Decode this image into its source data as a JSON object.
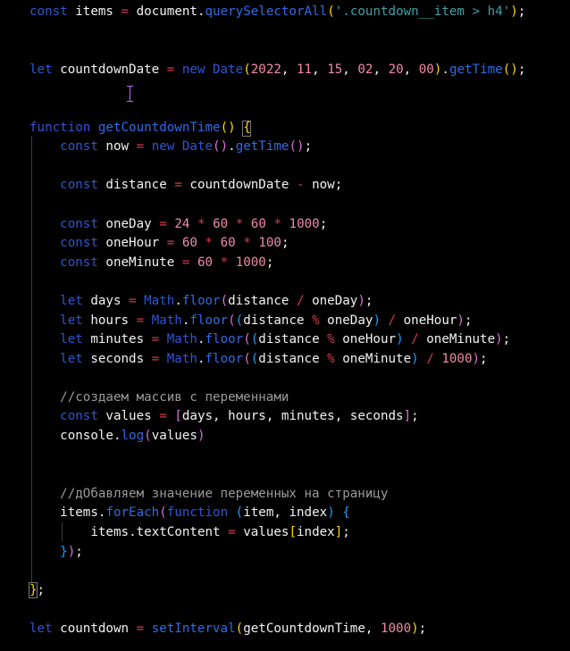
{
  "theme": {
    "background": "#000000",
    "keyword": "#2f55d4",
    "function_name": "#2f6be8",
    "plain": "#f2f2f2",
    "number": "#f08aa8",
    "string": "#3ea0a5",
    "operator": "#d43b4f",
    "comment": "#9a9a9a",
    "paren_outer": "#ffd700",
    "paren_inner": "#da70d6",
    "paren_third": "#179fff",
    "cursor": "#b76cf2"
  },
  "lines": [
    [
      {
        "t": "const",
        "k": "kw"
      },
      {
        "t": " ",
        "k": "p"
      },
      {
        "t": "items",
        "k": "p"
      },
      {
        "t": " ",
        "k": "p"
      },
      {
        "t": "=",
        "k": "op"
      },
      {
        "t": " ",
        "k": "p"
      },
      {
        "t": "document",
        "k": "p"
      },
      {
        "t": ".",
        "k": "p"
      },
      {
        "t": "querySelectorAll",
        "k": "fn"
      },
      {
        "t": "(",
        "k": "b1"
      },
      {
        "t": "'.countdown__item > h4'",
        "k": "str"
      },
      {
        "t": ")",
        "k": "b1"
      },
      {
        "t": ";",
        "k": "p"
      }
    ],
    [],
    [],
    [
      {
        "t": "let",
        "k": "kw"
      },
      {
        "t": " countdownDate ",
        "k": "p"
      },
      {
        "t": "=",
        "k": "op"
      },
      {
        "t": " ",
        "k": "p"
      },
      {
        "t": "new",
        "k": "kw"
      },
      {
        "t": " ",
        "k": "p"
      },
      {
        "t": "Date",
        "k": "kw"
      },
      {
        "t": "(",
        "k": "b1"
      },
      {
        "t": "2022",
        "k": "num"
      },
      {
        "t": ", ",
        "k": "p"
      },
      {
        "t": "11",
        "k": "num"
      },
      {
        "t": ", ",
        "k": "p"
      },
      {
        "t": "15",
        "k": "num"
      },
      {
        "t": ", ",
        "k": "p"
      },
      {
        "t": "02",
        "k": "num"
      },
      {
        "t": ", ",
        "k": "p"
      },
      {
        "t": "20",
        "k": "num"
      },
      {
        "t": ", ",
        "k": "p"
      },
      {
        "t": "00",
        "k": "num"
      },
      {
        "t": ")",
        "k": "b1"
      },
      {
        "t": ".",
        "k": "p"
      },
      {
        "t": "getTime",
        "k": "fn"
      },
      {
        "t": "()",
        "k": "b1"
      },
      {
        "t": ";",
        "k": "p"
      }
    ],
    [],
    [],
    [
      {
        "t": "function",
        "k": "kw"
      },
      {
        "t": " ",
        "k": "p"
      },
      {
        "t": "getCountdownTime",
        "k": "fn"
      },
      {
        "t": "()",
        "k": "b1"
      },
      {
        "t": " ",
        "k": "p"
      },
      {
        "t": "{",
        "k": "b1"
      }
    ],
    [
      {
        "t": "    ",
        "k": "p"
      },
      {
        "t": "const",
        "k": "kw"
      },
      {
        "t": " now ",
        "k": "p"
      },
      {
        "t": "=",
        "k": "op"
      },
      {
        "t": " ",
        "k": "p"
      },
      {
        "t": "new",
        "k": "kw"
      },
      {
        "t": " ",
        "k": "p"
      },
      {
        "t": "Date",
        "k": "kw"
      },
      {
        "t": "()",
        "k": "b2"
      },
      {
        "t": ".",
        "k": "p"
      },
      {
        "t": "getTime",
        "k": "fn"
      },
      {
        "t": "()",
        "k": "b2"
      },
      {
        "t": ";",
        "k": "p"
      }
    ],
    [],
    [
      {
        "t": "    ",
        "k": "p"
      },
      {
        "t": "const",
        "k": "kw"
      },
      {
        "t": " distance ",
        "k": "p"
      },
      {
        "t": "=",
        "k": "op"
      },
      {
        "t": " countdownDate ",
        "k": "p"
      },
      {
        "t": "-",
        "k": "op"
      },
      {
        "t": " now;",
        "k": "p"
      }
    ],
    [],
    [
      {
        "t": "    ",
        "k": "p"
      },
      {
        "t": "const",
        "k": "kw"
      },
      {
        "t": " oneDay ",
        "k": "p"
      },
      {
        "t": "=",
        "k": "op"
      },
      {
        "t": " ",
        "k": "p"
      },
      {
        "t": "24",
        "k": "num"
      },
      {
        "t": " ",
        "k": "p"
      },
      {
        "t": "*",
        "k": "op"
      },
      {
        "t": " ",
        "k": "p"
      },
      {
        "t": "60",
        "k": "num"
      },
      {
        "t": " ",
        "k": "p"
      },
      {
        "t": "*",
        "k": "op"
      },
      {
        "t": " ",
        "k": "p"
      },
      {
        "t": "60",
        "k": "num"
      },
      {
        "t": " ",
        "k": "p"
      },
      {
        "t": "*",
        "k": "op"
      },
      {
        "t": " ",
        "k": "p"
      },
      {
        "t": "1000",
        "k": "num"
      },
      {
        "t": ";",
        "k": "p"
      }
    ],
    [
      {
        "t": "    ",
        "k": "p"
      },
      {
        "t": "const",
        "k": "kw"
      },
      {
        "t": " oneHour ",
        "k": "p"
      },
      {
        "t": "=",
        "k": "op"
      },
      {
        "t": " ",
        "k": "p"
      },
      {
        "t": "60",
        "k": "num"
      },
      {
        "t": " ",
        "k": "p"
      },
      {
        "t": "*",
        "k": "op"
      },
      {
        "t": " ",
        "k": "p"
      },
      {
        "t": "60",
        "k": "num"
      },
      {
        "t": " ",
        "k": "p"
      },
      {
        "t": "*",
        "k": "op"
      },
      {
        "t": " ",
        "k": "p"
      },
      {
        "t": "100",
        "k": "num"
      },
      {
        "t": ";",
        "k": "p"
      }
    ],
    [
      {
        "t": "    ",
        "k": "p"
      },
      {
        "t": "const",
        "k": "kw"
      },
      {
        "t": " oneMinute ",
        "k": "p"
      },
      {
        "t": "=",
        "k": "op"
      },
      {
        "t": " ",
        "k": "p"
      },
      {
        "t": "60",
        "k": "num"
      },
      {
        "t": " ",
        "k": "p"
      },
      {
        "t": "*",
        "k": "op"
      },
      {
        "t": " ",
        "k": "p"
      },
      {
        "t": "1000",
        "k": "num"
      },
      {
        "t": ";",
        "k": "p"
      }
    ],
    [],
    [
      {
        "t": "    ",
        "k": "p"
      },
      {
        "t": "let",
        "k": "kw"
      },
      {
        "t": " days ",
        "k": "p"
      },
      {
        "t": "=",
        "k": "op"
      },
      {
        "t": " ",
        "k": "p"
      },
      {
        "t": "Math",
        "k": "kw"
      },
      {
        "t": ".",
        "k": "p"
      },
      {
        "t": "floor",
        "k": "fn"
      },
      {
        "t": "(",
        "k": "b2"
      },
      {
        "t": "distance ",
        "k": "p"
      },
      {
        "t": "/",
        "k": "op"
      },
      {
        "t": " oneDay",
        "k": "p"
      },
      {
        "t": ")",
        "k": "b2"
      },
      {
        "t": ";",
        "k": "p"
      }
    ],
    [
      {
        "t": "    ",
        "k": "p"
      },
      {
        "t": "let",
        "k": "kw"
      },
      {
        "t": " hours ",
        "k": "p"
      },
      {
        "t": "=",
        "k": "op"
      },
      {
        "t": " ",
        "k": "p"
      },
      {
        "t": "Math",
        "k": "kw"
      },
      {
        "t": ".",
        "k": "p"
      },
      {
        "t": "floor",
        "k": "fn"
      },
      {
        "t": "(",
        "k": "b2"
      },
      {
        "t": "(",
        "k": "b3"
      },
      {
        "t": "distance ",
        "k": "p"
      },
      {
        "t": "%",
        "k": "op"
      },
      {
        "t": " oneDay",
        "k": "p"
      },
      {
        "t": ")",
        "k": "b3"
      },
      {
        "t": " ",
        "k": "p"
      },
      {
        "t": "/",
        "k": "op"
      },
      {
        "t": " oneHour",
        "k": "p"
      },
      {
        "t": ")",
        "k": "b2"
      },
      {
        "t": ";",
        "k": "p"
      }
    ],
    [
      {
        "t": "    ",
        "k": "p"
      },
      {
        "t": "let",
        "k": "kw"
      },
      {
        "t": " minutes ",
        "k": "p"
      },
      {
        "t": "=",
        "k": "op"
      },
      {
        "t": " ",
        "k": "p"
      },
      {
        "t": "Math",
        "k": "kw"
      },
      {
        "t": ".",
        "k": "p"
      },
      {
        "t": "floor",
        "k": "fn"
      },
      {
        "t": "(",
        "k": "b2"
      },
      {
        "t": "(",
        "k": "b3"
      },
      {
        "t": "distance ",
        "k": "p"
      },
      {
        "t": "%",
        "k": "op"
      },
      {
        "t": " oneHour",
        "k": "p"
      },
      {
        "t": ")",
        "k": "b3"
      },
      {
        "t": " ",
        "k": "p"
      },
      {
        "t": "/",
        "k": "op"
      },
      {
        "t": " oneMinute",
        "k": "p"
      },
      {
        "t": ")",
        "k": "b2"
      },
      {
        "t": ";",
        "k": "p"
      }
    ],
    [
      {
        "t": "    ",
        "k": "p"
      },
      {
        "t": "let",
        "k": "kw"
      },
      {
        "t": " seconds ",
        "k": "p"
      },
      {
        "t": "=",
        "k": "op"
      },
      {
        "t": " ",
        "k": "p"
      },
      {
        "t": "Math",
        "k": "kw"
      },
      {
        "t": ".",
        "k": "p"
      },
      {
        "t": "floor",
        "k": "fn"
      },
      {
        "t": "(",
        "k": "b2"
      },
      {
        "t": "(",
        "k": "b3"
      },
      {
        "t": "distance ",
        "k": "p"
      },
      {
        "t": "%",
        "k": "op"
      },
      {
        "t": " oneMinute",
        "k": "p"
      },
      {
        "t": ")",
        "k": "b3"
      },
      {
        "t": " ",
        "k": "p"
      },
      {
        "t": "/",
        "k": "op"
      },
      {
        "t": " ",
        "k": "p"
      },
      {
        "t": "1000",
        "k": "num"
      },
      {
        "t": ")",
        "k": "b2"
      },
      {
        "t": ";",
        "k": "p"
      }
    ],
    [],
    [
      {
        "t": "    ",
        "k": "p"
      },
      {
        "t": "//создаем массив с переменнами",
        "k": "cm"
      }
    ],
    [
      {
        "t": "    ",
        "k": "p"
      },
      {
        "t": "const",
        "k": "kw"
      },
      {
        "t": " values ",
        "k": "p"
      },
      {
        "t": "=",
        "k": "op"
      },
      {
        "t": " ",
        "k": "p"
      },
      {
        "t": "[",
        "k": "b2"
      },
      {
        "t": "days, hours, minutes, seconds",
        "k": "p"
      },
      {
        "t": "]",
        "k": "b2"
      },
      {
        "t": ";",
        "k": "p"
      }
    ],
    [
      {
        "t": "    ",
        "k": "p"
      },
      {
        "t": "console",
        "k": "p"
      },
      {
        "t": ".",
        "k": "p"
      },
      {
        "t": "log",
        "k": "fn"
      },
      {
        "t": "(",
        "k": "b2"
      },
      {
        "t": "values",
        "k": "p"
      },
      {
        "t": ")",
        "k": "b2"
      }
    ],
    [],
    [],
    [
      {
        "t": "    ",
        "k": "p"
      },
      {
        "t": "//дОбавляем значение переменных на страницу",
        "k": "cm"
      }
    ],
    [
      {
        "t": "    ",
        "k": "p"
      },
      {
        "t": "items",
        "k": "p"
      },
      {
        "t": ".",
        "k": "p"
      },
      {
        "t": "forEach",
        "k": "fn"
      },
      {
        "t": "(",
        "k": "b2"
      },
      {
        "t": "function",
        "k": "kw"
      },
      {
        "t": " ",
        "k": "p"
      },
      {
        "t": "(",
        "k": "b3"
      },
      {
        "t": "item, index",
        "k": "p"
      },
      {
        "t": ")",
        "k": "b3"
      },
      {
        "t": " ",
        "k": "p"
      },
      {
        "t": "{",
        "k": "b3"
      }
    ],
    [
      {
        "t": "        ",
        "k": "p"
      },
      {
        "t": "items",
        "k": "p"
      },
      {
        "t": ".",
        "k": "p"
      },
      {
        "t": "textContent ",
        "k": "p"
      },
      {
        "t": "=",
        "k": "op"
      },
      {
        "t": " values",
        "k": "p"
      },
      {
        "t": "[",
        "k": "b1"
      },
      {
        "t": "index",
        "k": "p"
      },
      {
        "t": "]",
        "k": "b1"
      },
      {
        "t": ";",
        "k": "p"
      }
    ],
    [
      {
        "t": "    ",
        "k": "p"
      },
      {
        "t": "}",
        "k": "b3"
      },
      {
        "t": ")",
        "k": "b2"
      },
      {
        "t": ";",
        "k": "p"
      }
    ],
    [],
    [
      {
        "t": "}",
        "k": "b1"
      },
      {
        "t": ";",
        "k": "p"
      }
    ],
    [],
    [
      {
        "t": "let",
        "k": "kw"
      },
      {
        "t": " countdown ",
        "k": "p"
      },
      {
        "t": "=",
        "k": "op"
      },
      {
        "t": " ",
        "k": "p"
      },
      {
        "t": "setInterval",
        "k": "fn"
      },
      {
        "t": "(",
        "k": "b1"
      },
      {
        "t": "getCountdownTime, ",
        "k": "p"
      },
      {
        "t": "1000",
        "k": "num"
      },
      {
        "t": ")",
        "k": "b1"
      },
      {
        "t": ";",
        "k": "p"
      }
    ]
  ]
}
